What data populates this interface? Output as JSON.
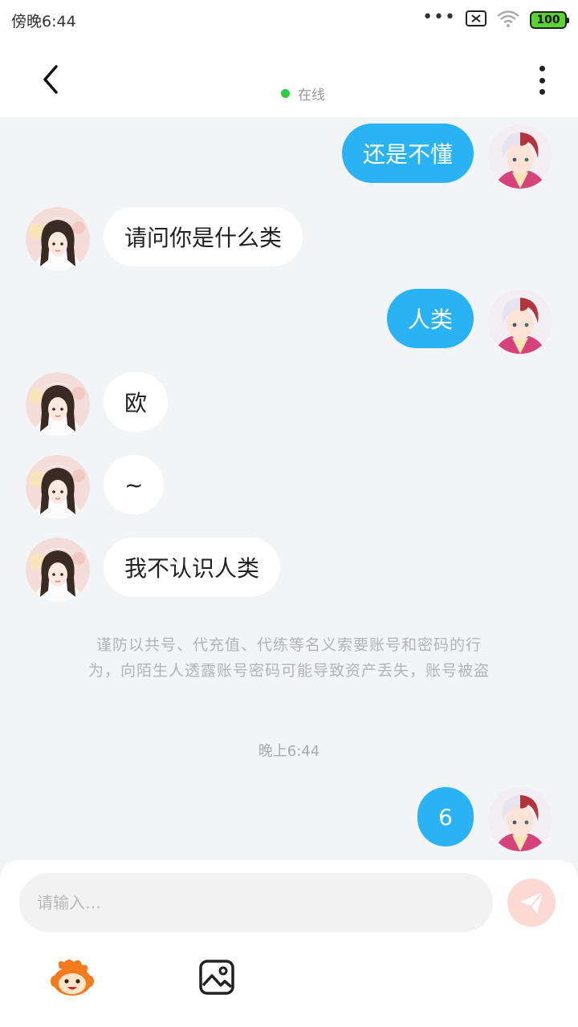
{
  "status_bar": {
    "time": "傍晚6:44",
    "dots": "•••",
    "battery": "100"
  },
  "header": {
    "status_text": "在线"
  },
  "messages": [
    {
      "sender": "self",
      "text": "还是不懂"
    },
    {
      "sender": "other",
      "text": "请问你是什么类"
    },
    {
      "sender": "self",
      "text": "人类"
    },
    {
      "sender": "other",
      "text": "欧"
    },
    {
      "sender": "other",
      "text": "~"
    },
    {
      "sender": "other",
      "text": "我不认识人类"
    },
    {
      "sender": "self",
      "text": "6"
    }
  ],
  "notice": {
    "line1": "谨防以共号、代充值、代练等名义索要账号和密码的行",
    "line2": "为，向陌生人透露账号密码可能导致资产丢失，账号被盗"
  },
  "timestamp": "晚上6:44",
  "input": {
    "placeholder": "请输入…"
  },
  "colors": {
    "self_bubble": "#29b3f5",
    "other_bubble": "#ffffff",
    "online": "#2ecc40",
    "send_disabled": "#fbd9d5"
  },
  "icons": [
    "back-icon",
    "more-icon",
    "send-icon",
    "emoji-icon",
    "image-icon"
  ]
}
